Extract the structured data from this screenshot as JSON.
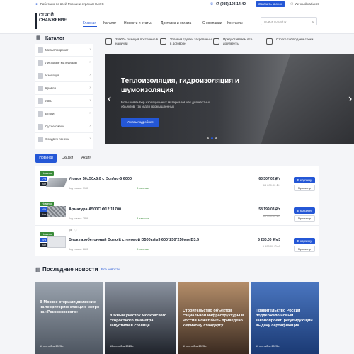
{
  "topbar": {
    "region": "Работаем по всей России и странам ЕАЭС",
    "phone": "+7 (985) 103-14-40",
    "callback": "Заказать звонок",
    "account": "Личный кабинет"
  },
  "header": {
    "logo_line1": "СТРОЙ",
    "logo_line2": "СНАБЖЕНИЕ",
    "nav": [
      "Главная",
      "Каталог",
      "Новости и статьи",
      "Доставка и оплата",
      "О компании",
      "Контакты"
    ],
    "search_placeholder": "Поиск по сайту"
  },
  "catalog": {
    "title": "Каталог",
    "items": [
      "Металлопрокат",
      "Листовые материалы",
      "Изоляция",
      "Кровля",
      "ЖБИ",
      "Блоки",
      "Сухие смеси",
      "Сэндвич панели"
    ]
  },
  "advantages": [
    "25000+ позиций постоянно в наличии",
    "Условия сделки закреплены в договоре",
    "Предоставляем все документы",
    "Строго соблюдаем сроки"
  ],
  "banner": {
    "title": "Теплоизоляция, гидроизоляция и шумоизоляция",
    "subtitle": "Большой выбор изоляционных материалов как для частных объектов, так и для промышленных",
    "button": "Узнать подробнее",
    "prev": "‹",
    "next": "›",
    "active_slide": 2,
    "total_slides": 3
  },
  "tabs": [
    "Новинки",
    "Скидки",
    "Акция"
  ],
  "products": [
    {
      "badge": "Новинка",
      "discount": "-7%",
      "extra": "Хит",
      "name": "Уголок 50х50х5.0 ст3сп/пс-5 6000",
      "code": "Код товара: 3130",
      "stock": "В наличии",
      "price": "63 307.02 ₽/т",
      "old": "64 600.00 ₽/т",
      "cart": "В корзину",
      "view": "Просмотр"
    },
    {
      "badge": "Новинка",
      "discount": "-4%",
      "extra": "Хит",
      "name": "Арматура А500С Ф12 11700",
      "code": "Код товара: 2899",
      "stock": "В наличии",
      "price": "58 199.03 ₽/т",
      "old": "60 000.00 ₽/т",
      "cart": "В корзину",
      "view": "Просмотр"
    },
    {
      "badge": "Новинка",
      "discount": "-4%",
      "extra": "Хит",
      "name": "Блок газобетонный Bonolit стеновой D500кг/м3 600*250*250мм В3,5",
      "code": "Код товара: 2601",
      "stock": "В наличии",
      "price": "5 280.00 ₽/м3",
      "old": "5 500.00 ₽/м3",
      "cart": "В корзину",
      "view": "Просмотр"
    }
  ],
  "news": {
    "title": "Последние новости",
    "all": "Все новости",
    "items": [
      {
        "text": "В Москве открыли движение на территорию станцию метро на «Рокоссовского»",
        "date": "10 сентября 2023 г.",
        "bg": "#7d8794"
      },
      {
        "text": "Южный участок Московского скоростного диаметра запустили в столице",
        "date": "10 сентября 2023 г.",
        "bg": "#3a3f4a"
      },
      {
        "text": "Строительство объектов социальной инфраструктуры в России может быть приведено к единому стандарту",
        "date": "10 сентября 2023 г.",
        "bg": "#6a4f3f"
      },
      {
        "text": "Правительство России поддержало новый законопроект, регулирующий выдачу сертификации",
        "date": "10 сентября 2023 г.",
        "bg": "#2d4e8c"
      }
    ]
  },
  "colors": {
    "accent": "#2457d6",
    "green": "#3b8c3a",
    "dark": "#1d2430"
  }
}
